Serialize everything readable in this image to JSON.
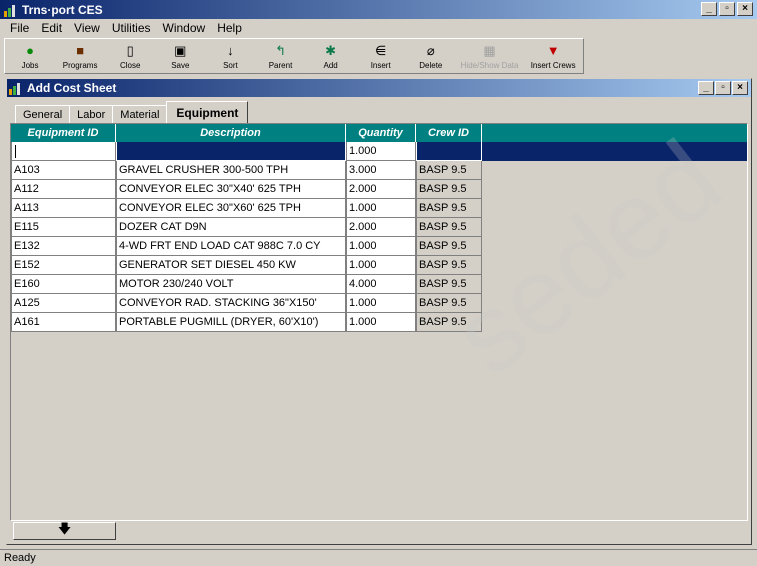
{
  "app": {
    "title": "Trns·port CES"
  },
  "window_controls": {
    "minimize": "_",
    "maximize": "▫",
    "close": "×"
  },
  "menu": [
    {
      "label": "File",
      "key": "F"
    },
    {
      "label": "Edit",
      "key": "E"
    },
    {
      "label": "View",
      "key": "V"
    },
    {
      "label": "Utilities",
      "key": "U"
    },
    {
      "label": "Window",
      "key": "W"
    },
    {
      "label": "Help",
      "key": "H"
    }
  ],
  "toolbar": {
    "jobs": "Jobs",
    "programs": "Programs",
    "close": "Close",
    "save": "Save",
    "sort": "Sort",
    "parent": "Parent",
    "add": "Add",
    "insert": "Insert",
    "delete": "Delete",
    "hide_show_data": "Hide/Show Data",
    "insert_crews": "Insert Crews"
  },
  "child_window": {
    "title": "Add Cost Sheet"
  },
  "tabs": [
    {
      "label": "General"
    },
    {
      "label": "Labor"
    },
    {
      "label": "Material"
    },
    {
      "label": "Equipment",
      "active": true
    }
  ],
  "grid": {
    "columns": [
      "Equipment ID",
      "Description",
      "Quantity",
      "Crew ID"
    ],
    "new_row": {
      "quantity": "1.000"
    },
    "rows": [
      {
        "id": "A103",
        "description": "GRAVEL CRUSHER 300-500 TPH",
        "quantity": "3.000",
        "crew": "BASP 9.5"
      },
      {
        "id": "A112",
        "description": "CONVEYOR ELEC 30\"X40' 625 TPH",
        "quantity": "2.000",
        "crew": "BASP 9.5"
      },
      {
        "id": "A113",
        "description": "CONVEYOR ELEC 30\"X60' 625 TPH",
        "quantity": "1.000",
        "crew": "BASP 9.5"
      },
      {
        "id": "E115",
        "description": "DOZER CAT D9N",
        "quantity": "2.000",
        "crew": "BASP 9.5"
      },
      {
        "id": "E132",
        "description": "4-WD FRT END LOAD CAT 988C 7.0 CY",
        "quantity": "1.000",
        "crew": "BASP 9.5"
      },
      {
        "id": "E152",
        "description": "GENERATOR SET DIESEL 450 KW",
        "quantity": "1.000",
        "crew": "BASP 9.5"
      },
      {
        "id": "E160",
        "description": "MOTOR 230/240 VOLT",
        "quantity": "4.000",
        "crew": "BASP 9.5"
      },
      {
        "id": "A125",
        "description": "CONVEYOR RAD. STACKING 36\"X150'",
        "quantity": "1.000",
        "crew": "BASP 9.5"
      },
      {
        "id": "A161",
        "description": "PORTABLE PUGMILL (DRYER, 60'X10')",
        "quantity": "1.000",
        "crew": "BASP 9.5"
      }
    ]
  },
  "nav": {
    "down_arrow": "🡇"
  },
  "status": {
    "text": "Ready"
  },
  "watermark": {
    "text": "seded"
  }
}
